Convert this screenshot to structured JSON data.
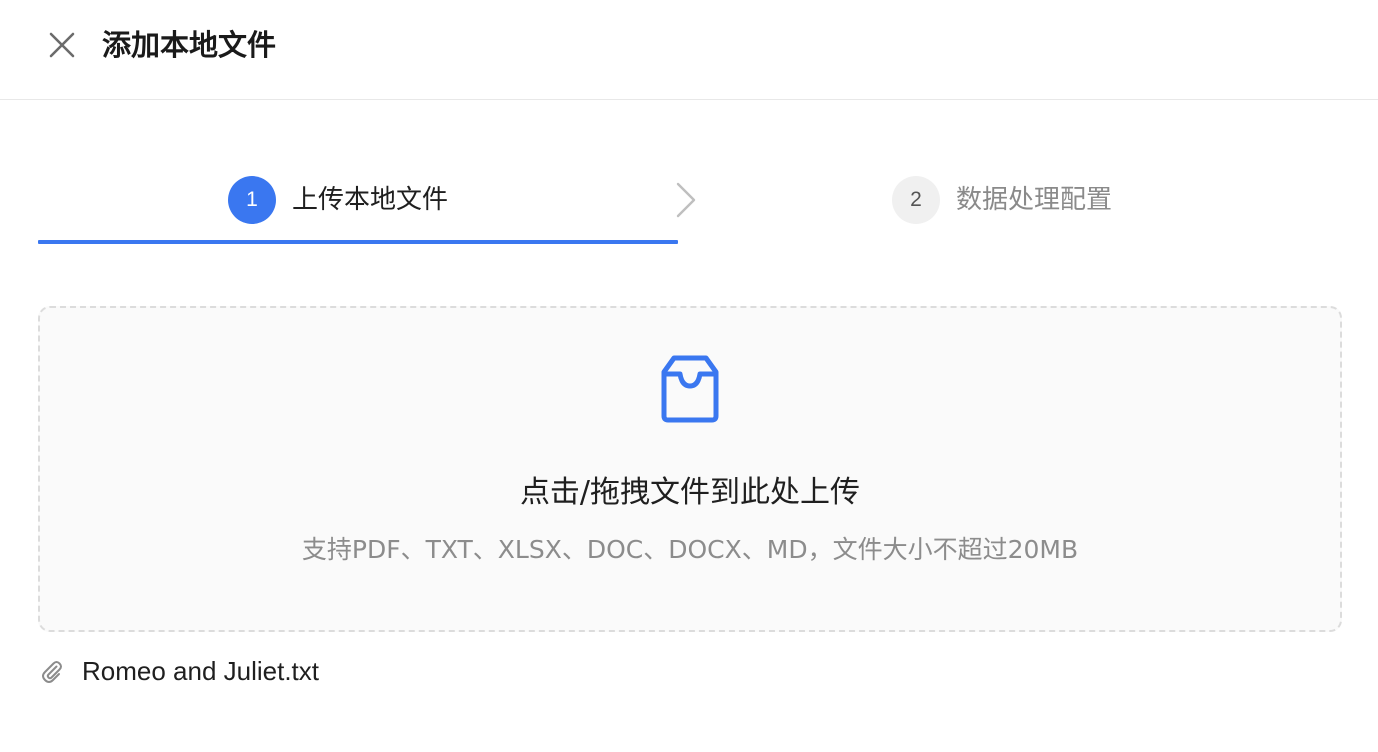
{
  "header": {
    "title": "添加本地文件",
    "close_icon": "close-icon"
  },
  "steps": [
    {
      "number": "1",
      "label": "上传本地文件",
      "active": true
    },
    {
      "number": "2",
      "label": "数据处理配置",
      "active": false
    }
  ],
  "upload": {
    "icon": "inbox-icon",
    "title": "点击/拖拽文件到此处上传",
    "hint": "支持PDF、TXT、XLSX、DOC、DOCX、MD，文件大小不超过20MB"
  },
  "file": {
    "icon": "paperclip-icon",
    "name": "Romeo and Juliet.txt"
  },
  "colors": {
    "accent": "#3a77f0",
    "muted_text": "#8c8c8c",
    "dropzone_bg": "#fafafa",
    "dropzone_border": "#dcdcdc"
  }
}
